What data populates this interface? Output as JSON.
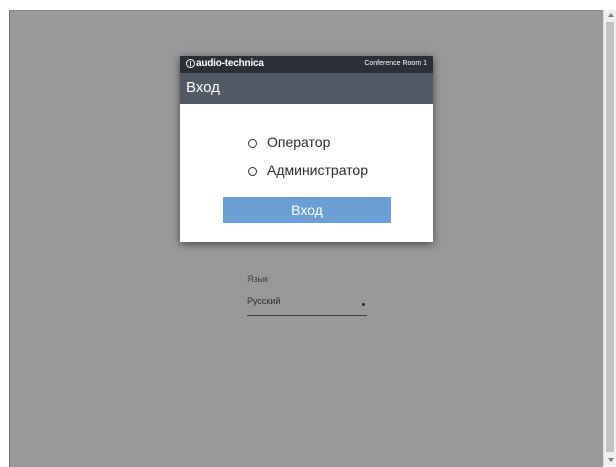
{
  "dialog": {
    "brand": "audio-technica",
    "room_name": "Conference Room 1",
    "title": "Вход",
    "roles": [
      {
        "label": "Оператор",
        "selected": false
      },
      {
        "label": "Администратор",
        "selected": false
      }
    ],
    "login_button": "Вход"
  },
  "language": {
    "label": "Язык",
    "value": "Русский"
  },
  "colors": {
    "backdrop": "#999999",
    "header": "#515a64",
    "topbar": "#2b3037",
    "button": "#6b9fd6"
  }
}
